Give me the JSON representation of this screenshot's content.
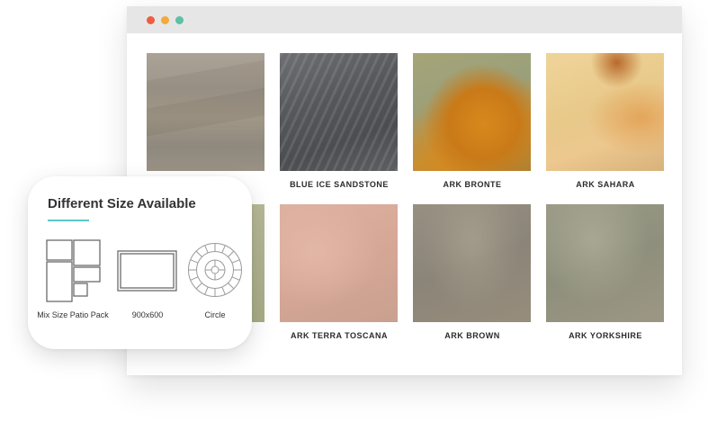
{
  "window": {
    "controls": [
      "close",
      "minimize",
      "maximize"
    ],
    "control_colors": [
      "#ee5d3f",
      "#f3a93b",
      "#5ec0a4"
    ]
  },
  "products": [
    {
      "label": ""
    },
    {
      "label": "BLUE ICE SANDSTONE"
    },
    {
      "label": "ARK BRONTE"
    },
    {
      "label": "ARK SAHARA"
    },
    {
      "label": ""
    },
    {
      "label": "ARK TERRA TOSCANA"
    },
    {
      "label": "ARK BROWN"
    },
    {
      "label": "ARK YORKSHIRE"
    }
  ],
  "size_card": {
    "title": "Different Size Available",
    "accent_color": "#5cc6c8",
    "options": [
      {
        "label": "Mix Size Patio Pack",
        "icon": "mix-size-pack-icon"
      },
      {
        "label": "900x600",
        "icon": "rectangle-slab-icon"
      },
      {
        "label": "Circle",
        "icon": "circle-paving-icon"
      }
    ]
  }
}
